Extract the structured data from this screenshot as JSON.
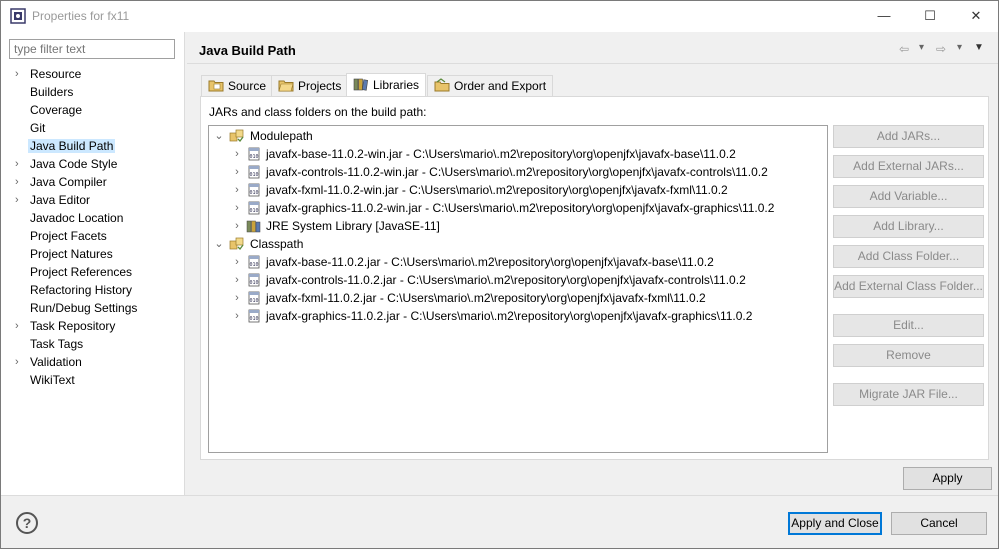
{
  "window": {
    "title": "Properties for fx11",
    "minimize": "—",
    "maximize": "☐",
    "close": "✕"
  },
  "filter": {
    "placeholder": "type filter text"
  },
  "nav": [
    {
      "label": "Resource",
      "expandable": true
    },
    {
      "label": "Builders",
      "expandable": false
    },
    {
      "label": "Coverage",
      "expandable": false
    },
    {
      "label": "Git",
      "expandable": false
    },
    {
      "label": "Java Build Path",
      "expandable": false,
      "selected": true
    },
    {
      "label": "Java Code Style",
      "expandable": true
    },
    {
      "label": "Java Compiler",
      "expandable": true
    },
    {
      "label": "Java Editor",
      "expandable": true
    },
    {
      "label": "Javadoc Location",
      "expandable": false
    },
    {
      "label": "Project Facets",
      "expandable": false
    },
    {
      "label": "Project Natures",
      "expandable": false
    },
    {
      "label": "Project References",
      "expandable": false
    },
    {
      "label": "Refactoring History",
      "expandable": false
    },
    {
      "label": "Run/Debug Settings",
      "expandable": false
    },
    {
      "label": "Task Repository",
      "expandable": true
    },
    {
      "label": "Task Tags",
      "expandable": false
    },
    {
      "label": "Validation",
      "expandable": true
    },
    {
      "label": "WikiText",
      "expandable": false
    }
  ],
  "page": {
    "title": "Java Build Path",
    "back_glyph": "⇦",
    "forward_glyph": "⇨",
    "dropdown_glyph": "▾",
    "menu_glyph": "▼"
  },
  "tabs": [
    {
      "label": "Source",
      "icon": "source-folder-icon"
    },
    {
      "label": "Projects",
      "icon": "projects-folder-icon"
    },
    {
      "label": "Libraries",
      "icon": "libraries-icon",
      "active": true
    },
    {
      "label": "Order and Export",
      "icon": "order-export-icon"
    }
  ],
  "libraries": {
    "label": "JARs and class folders on the build path:",
    "tree": [
      {
        "level": 0,
        "expanded": true,
        "icon": "modulepath-icon",
        "text": "Modulepath"
      },
      {
        "level": 1,
        "expanded": false,
        "icon": "jar-icon",
        "text": "javafx-base-11.0.2-win.jar - C:\\Users\\mario\\.m2\\repository\\org\\openjfx\\javafx-base\\11.0.2"
      },
      {
        "level": 1,
        "expanded": false,
        "icon": "jar-icon",
        "text": "javafx-controls-11.0.2-win.jar - C:\\Users\\mario\\.m2\\repository\\org\\openjfx\\javafx-controls\\11.0.2"
      },
      {
        "level": 1,
        "expanded": false,
        "icon": "jar-icon",
        "text": "javafx-fxml-11.0.2-win.jar - C:\\Users\\mario\\.m2\\repository\\org\\openjfx\\javafx-fxml\\11.0.2"
      },
      {
        "level": 1,
        "expanded": false,
        "icon": "jar-icon",
        "text": "javafx-graphics-11.0.2-win.jar - C:\\Users\\mario\\.m2\\repository\\org\\openjfx\\javafx-graphics\\11.0.2"
      },
      {
        "level": 1,
        "expanded": false,
        "icon": "library-icon",
        "text": "JRE System Library [JavaSE-11]"
      },
      {
        "level": 0,
        "expanded": true,
        "icon": "classpath-icon",
        "text": "Classpath"
      },
      {
        "level": 1,
        "expanded": false,
        "icon": "jar-icon",
        "text": "javafx-base-11.0.2.jar - C:\\Users\\mario\\.m2\\repository\\org\\openjfx\\javafx-base\\11.0.2"
      },
      {
        "level": 1,
        "expanded": false,
        "icon": "jar-icon",
        "text": "javafx-controls-11.0.2.jar - C:\\Users\\mario\\.m2\\repository\\org\\openjfx\\javafx-controls\\11.0.2"
      },
      {
        "level": 1,
        "expanded": false,
        "icon": "jar-icon",
        "text": "javafx-fxml-11.0.2.jar - C:\\Users\\mario\\.m2\\repository\\org\\openjfx\\javafx-fxml\\11.0.2"
      },
      {
        "level": 1,
        "expanded": false,
        "icon": "jar-icon",
        "text": "javafx-graphics-11.0.2.jar - C:\\Users\\mario\\.m2\\repository\\org\\openjfx\\javafx-graphics\\11.0.2"
      }
    ],
    "buttons": {
      "add_jars": "Add JARs...",
      "add_external_jars": "Add External JARs...",
      "add_variable": "Add Variable...",
      "add_library": "Add Library...",
      "add_class_folder": "Add Class Folder...",
      "add_external_class_folder": "Add External Class Folder...",
      "edit": "Edit...",
      "remove": "Remove",
      "migrate_jar": "Migrate JAR File..."
    }
  },
  "footer": {
    "apply": "Apply",
    "apply_close": "Apply and Close",
    "cancel": "Cancel",
    "help": "?"
  }
}
